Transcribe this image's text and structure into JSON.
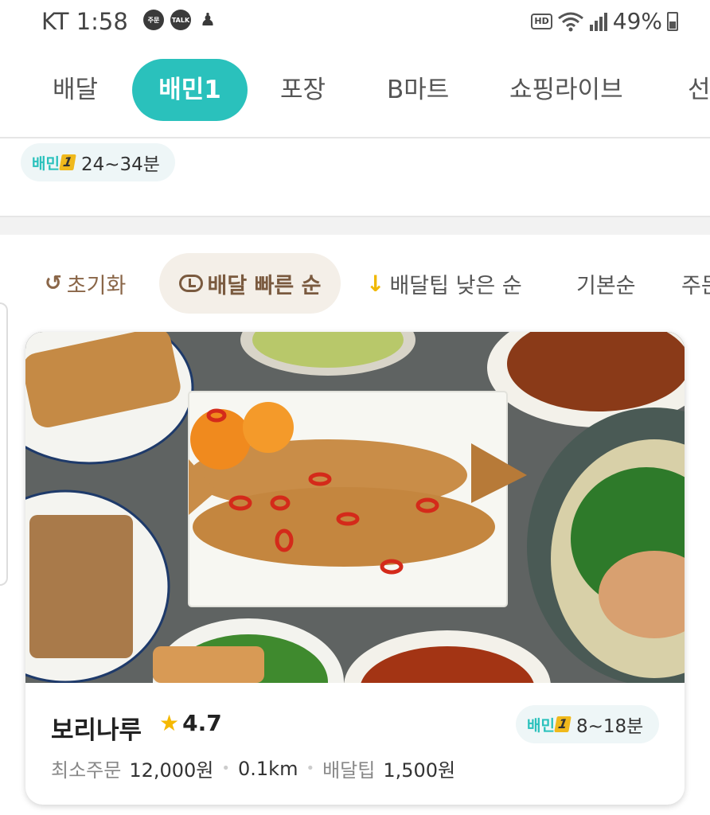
{
  "status_bar": {
    "carrier_time": "KT 1:58",
    "notif_order": "주문",
    "notif_talk": "TALK",
    "hd": "HD",
    "battery": "49%"
  },
  "tabs": [
    {
      "label": "배달"
    },
    {
      "label": "배민1"
    },
    {
      "label": "포장"
    },
    {
      "label": "B마트"
    },
    {
      "label": "쇼핑라이브"
    },
    {
      "label": "선"
    }
  ],
  "baemin1_info": {
    "logo": "배민",
    "logo_one": "1",
    "time": "24~34분"
  },
  "sort": {
    "reset": "초기화",
    "fast": "배달 빠른 순",
    "low_tip": "배달팁 낮은 순",
    "basic": "기본순",
    "orders": "주문"
  },
  "store": {
    "name": "보리나루",
    "rating": "4.7",
    "badge_logo": "배민",
    "badge_one": "1",
    "delivery_time": "8~18분",
    "min_order_label": "최소주문",
    "min_order_value": "12,000원",
    "distance": "0.1km",
    "tip_label": "배달팁",
    "tip_value": "1,500원"
  },
  "colors": {
    "mint": "#2ac1bc",
    "brown": "#7a5a3f",
    "star": "#f5b800"
  }
}
